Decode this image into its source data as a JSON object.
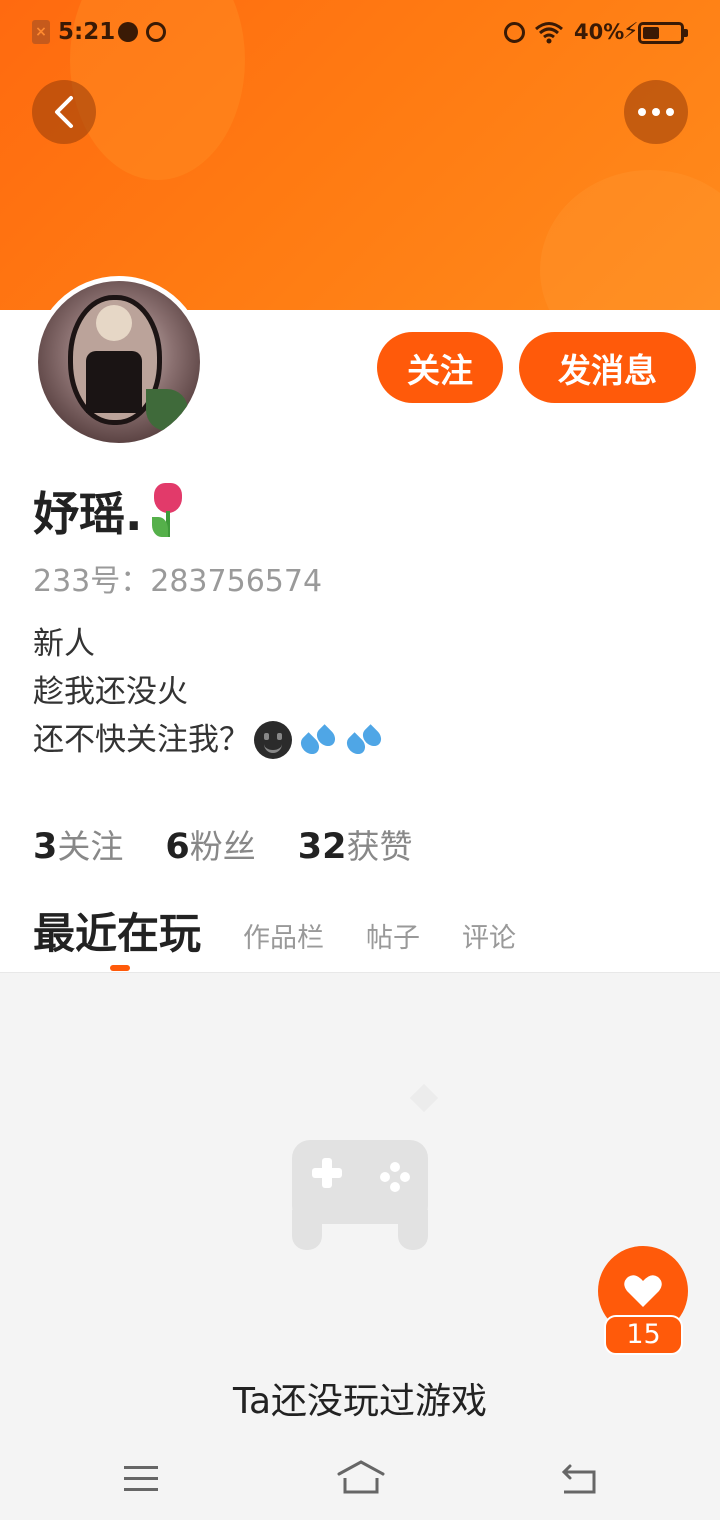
{
  "status_bar": {
    "time": "5:21",
    "battery": "40%"
  },
  "profile": {
    "nickname": "妤瑶.",
    "uid": "233号：283756574",
    "bio": [
      "新人",
      "趁我还没火",
      "还不快关注我？"
    ]
  },
  "actions": {
    "follow_label": "关注",
    "message_label": "发消息"
  },
  "stats": [
    {
      "num": "3",
      "label": "关注"
    },
    {
      "num": "6",
      "label": "粉丝"
    },
    {
      "num": "32",
      "label": "获赞"
    }
  ],
  "tabs": [
    {
      "label": "最近在玩",
      "active": true
    },
    {
      "label": "作品栏",
      "active": false
    },
    {
      "label": "帖子",
      "active": false
    },
    {
      "label": "评论",
      "active": false
    }
  ],
  "empty_state": {
    "text": "Ta还没玩过游戏"
  },
  "like": {
    "count": "15"
  },
  "colors": {
    "accent": "#ff5a0a",
    "banner": "#ff7a12"
  }
}
